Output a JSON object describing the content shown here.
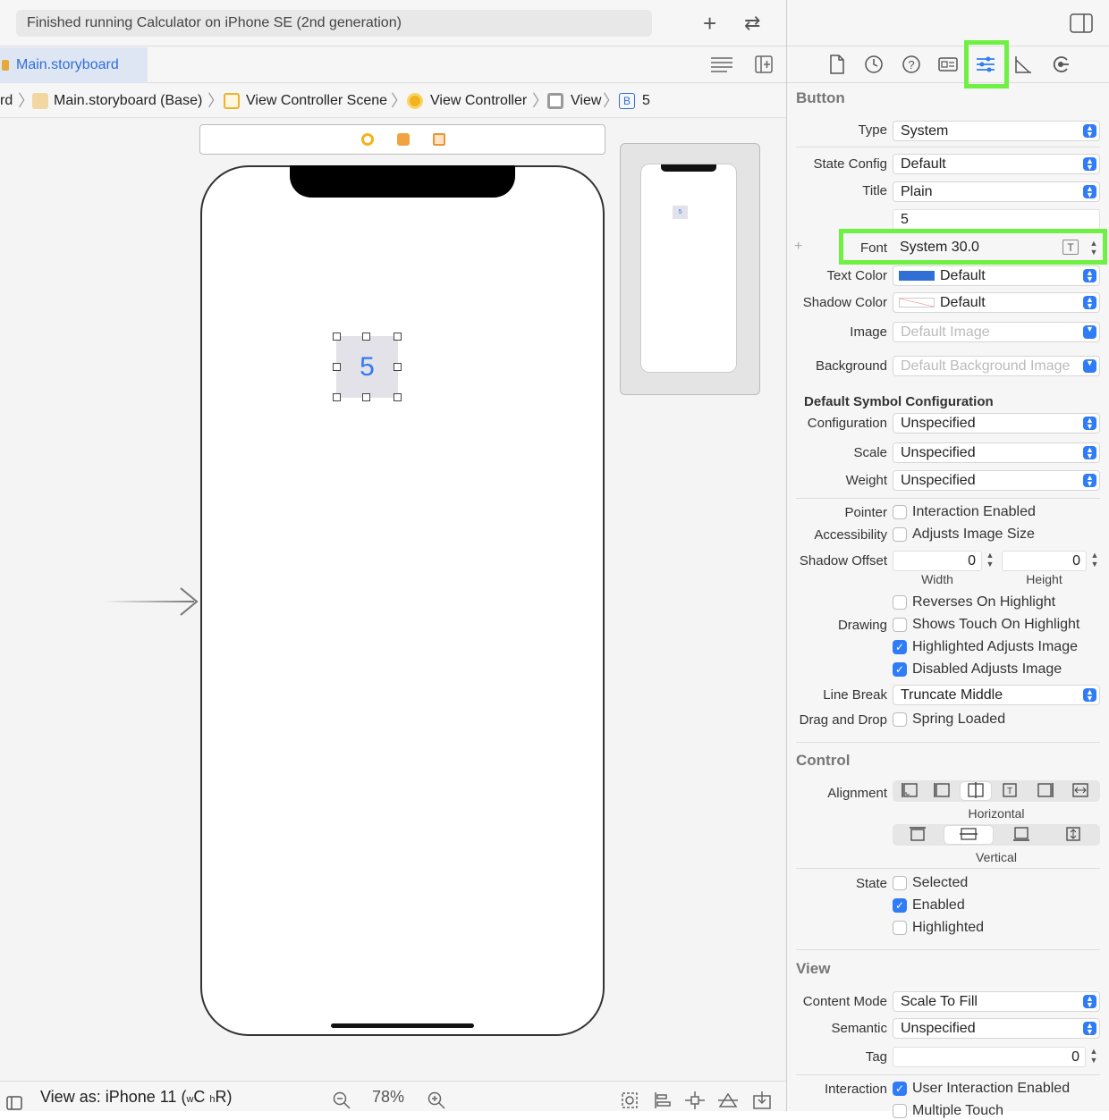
{
  "topbar": {
    "status": "Finished running Calculator on iPhone SE (2nd generation)",
    "add_icon": "plus-icon",
    "swap_icon": "swap-arrows-icon"
  },
  "tabbar": {
    "active_tab": "Main.storyboard"
  },
  "breadcrumb": {
    "items": [
      "rd",
      "Main.storyboard (Base)",
      "View Controller Scene",
      "View Controller",
      "View",
      "5"
    ],
    "b_badge": "B"
  },
  "canvas": {
    "button_title": "5",
    "mini_title": "5"
  },
  "bottombar": {
    "view_as": "View as: iPhone 11 (",
    "w": "w",
    "c": "C",
    "h": "h",
    "r": "R",
    "close": ")",
    "zoom": "78%"
  },
  "inspector": {
    "section_button": "Button",
    "type_label": "Type",
    "type_value": "System",
    "state_config_label": "State Config",
    "state_config_value": "Default",
    "title_label": "Title",
    "title_value": "Plain",
    "title_text": "5",
    "plus": "+",
    "font_label": "Font",
    "font_value": "System 30.0",
    "text_color_label": "Text Color",
    "text_color_value": "Default",
    "shadow_color_label": "Shadow Color",
    "shadow_color_value": "Default",
    "image_label": "Image",
    "image_placeholder": "Default Image",
    "background_label": "Background",
    "background_placeholder": "Default Background Image",
    "symbol_header": "Default Symbol Configuration",
    "configuration_label": "Configuration",
    "configuration_value": "Unspecified",
    "scale_label": "Scale",
    "scale_value": "Unspecified",
    "weight_label": "Weight",
    "weight_value": "Unspecified",
    "pointer_label": "Pointer",
    "pointer_check": "Interaction Enabled",
    "accessibility_label": "Accessibility",
    "accessibility_check": "Adjusts Image Size",
    "shadow_offset_label": "Shadow Offset",
    "shadow_w": "0",
    "shadow_h": "0",
    "width_caption": "Width",
    "height_caption": "Height",
    "drawing_label": "Drawing",
    "reverses": "Reverses On Highlight",
    "shows_touch": "Shows Touch On Highlight",
    "highlighted_adjusts": "Highlighted Adjusts Image",
    "disabled_adjusts": "Disabled Adjusts Image",
    "line_break_label": "Line Break",
    "line_break_value": "Truncate Middle",
    "drag_drop_label": "Drag and Drop",
    "spring_loaded": "Spring Loaded",
    "section_control": "Control",
    "alignment_label": "Alignment",
    "horizontal_caption": "Horizontal",
    "vertical_caption": "Vertical",
    "state_label": "State",
    "selected": "Selected",
    "enabled": "Enabled",
    "highlighted": "Highlighted",
    "section_view": "View",
    "content_mode_label": "Content Mode",
    "content_mode_value": "Scale To Fill",
    "semantic_label": "Semantic",
    "semantic_value": "Unspecified",
    "tag_label": "Tag",
    "tag_value": "0",
    "interaction_label": "Interaction",
    "user_interaction": "User Interaction Enabled",
    "multiple_touch": "Multiple Touch"
  },
  "colors": {
    "accent": "#2f7cf6",
    "highlight": "#6ef142",
    "text_color_swatch": "#2f6fd6"
  }
}
